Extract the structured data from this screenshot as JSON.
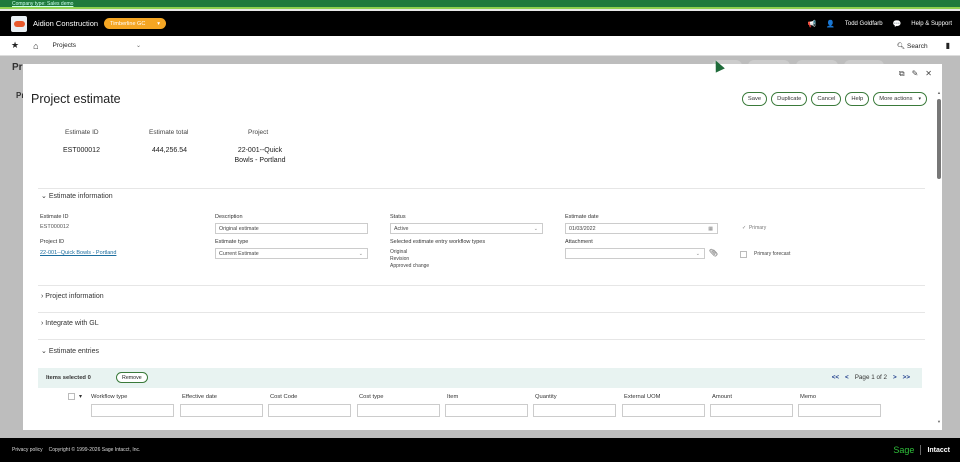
{
  "company_bar": {
    "text": "Company type: Sales demo"
  },
  "topbar": {
    "company_name": "Aidion Construction",
    "entity": "Timberline GC",
    "user": "Todd Goldfarb",
    "help": "Help & Support"
  },
  "navbar": {
    "module": "Projects",
    "search": "Search"
  },
  "modal": {
    "title": "Project estimate",
    "actions": [
      "Save",
      "Duplicate",
      "Cancel",
      "Help",
      "More actions"
    ],
    "summary": {
      "estimate_id_label": "Estimate ID",
      "estimate_id": "EST000012",
      "estimate_total_label": "Estimate total",
      "estimate_total": "444,256.54",
      "project_label": "Project",
      "project_line1": "22-001--Quick",
      "project_line2": "Bowls - Portland"
    },
    "estimate_information": {
      "heading": "Estimate information",
      "estimate_id_label": "Estimate ID",
      "estimate_id": "EST000012",
      "description_label": "Description",
      "description": "Original estimate",
      "status_label": "Status",
      "status": "Active",
      "estimate_date_label": "Estimate date",
      "estimate_date": "01/03/2022",
      "primary_label": "Primary",
      "project_id_label": "Project ID",
      "project_id": "22-001--Quick Bowls - Portland",
      "estimate_type_label": "Estimate type",
      "estimate_type": "Current Estimate",
      "workflow_label": "Selected estimate entry workflow types",
      "workflow_types": [
        "Original",
        "Revision",
        "Approved change"
      ],
      "attachment_label": "Attachment",
      "primary_forecast_label": "Primary forecast"
    },
    "sections": [
      "Project information",
      "Integrate with GL",
      "Estimate entries"
    ],
    "entries": {
      "items_selected": "Items selected 0",
      "remove": "Remove",
      "pager_first": "<<",
      "pager_prev": "<",
      "pager_text": "Page 1 of 2",
      "pager_next": ">",
      "pager_last": ">>",
      "columns": [
        "Workflow type",
        "Effective date",
        "Cost Code",
        "Cost type",
        "Item",
        "Quantity",
        "External UOM",
        "Amount",
        "Memo"
      ]
    }
  },
  "footer": {
    "privacy": "Privacy policy",
    "copyright": "Copyright © 1999-2026 Sage Intacct, Inc.",
    "brand": "Sage",
    "product": "Intacct"
  },
  "colors": {
    "green_bar": "#1f7a3c",
    "entity_pill": "#f5a623",
    "button_border": "#3a7a3a",
    "link": "#1b6d9e"
  }
}
